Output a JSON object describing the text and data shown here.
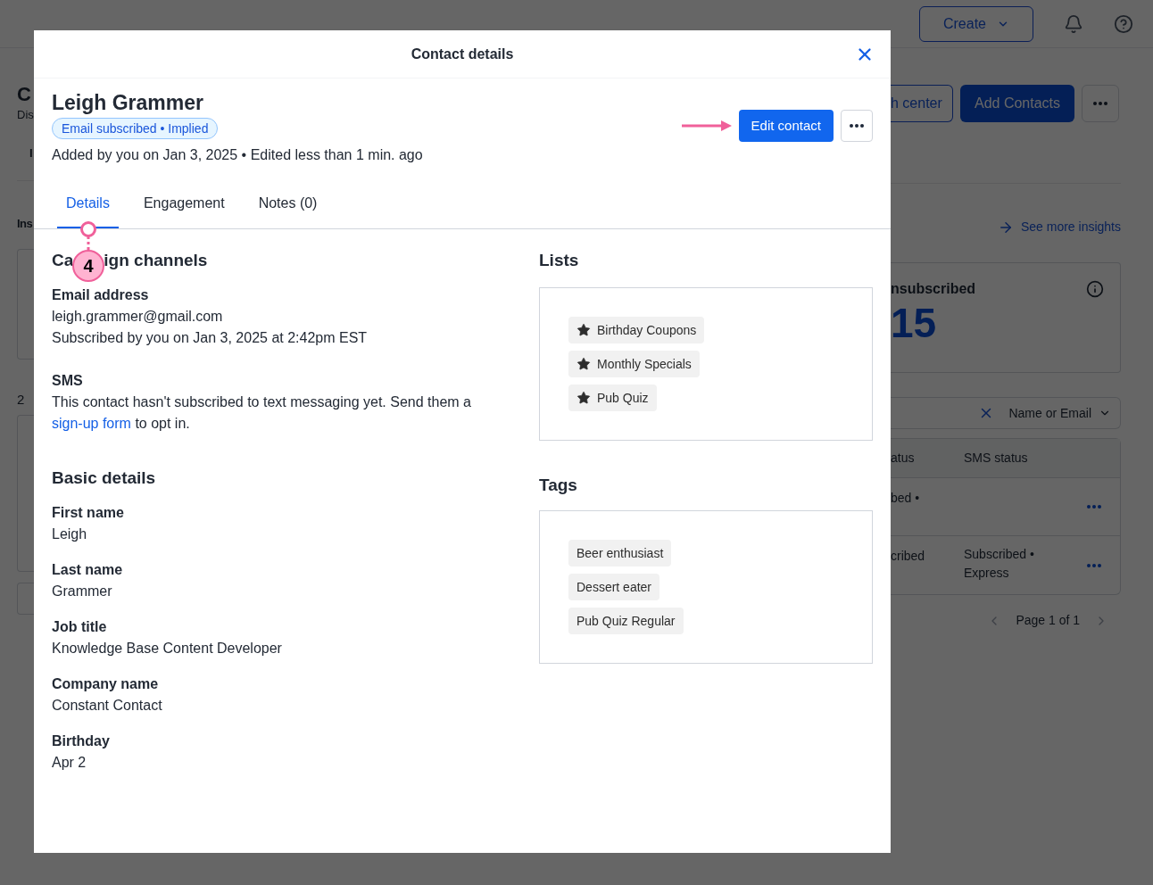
{
  "background_page": {
    "header": {
      "create_button": "Create"
    },
    "left_fragments": {
      "title": "C",
      "subtitle": "Dis",
      "tab": "I",
      "section": "Ins",
      "count": "2"
    },
    "actions": {
      "help_center": "h center",
      "add_contacts": "Add Contacts"
    },
    "see_more_link": "See more insights",
    "card": {
      "label": "nsubscribed",
      "value": "15"
    },
    "search": {
      "filter": "Name or Email"
    },
    "table": {
      "columns": [
        "atus",
        "SMS status"
      ],
      "rows": [
        {
          "cells": [
            "bed •",
            ""
          ]
        },
        {
          "cells": [
            "cribed",
            "Subscribed • Express"
          ]
        }
      ]
    },
    "pagination": "Page 1 of 1"
  },
  "modal": {
    "title": "Contact details",
    "contact": {
      "name": "Leigh Grammer",
      "status_badge": "Email subscribed • Implied",
      "meta": "Added by you on Jan 3, 2025 • Edited less than 1 min. ago"
    },
    "edit_button": "Edit contact",
    "tabs": [
      {
        "label": "Details",
        "selected": true
      },
      {
        "label": "Engagement",
        "selected": false
      },
      {
        "label": "Notes (0)",
        "selected": false
      }
    ],
    "campaign_channels": {
      "heading_parts": [
        "Ca",
        "ign channels"
      ],
      "email": {
        "label": "Email address",
        "value": "leigh.grammer@gmail.com",
        "note": "Subscribed by you on Jan 3, 2025 at 2:42pm EST"
      },
      "sms": {
        "label": "SMS",
        "text": "This contact hasn't subscribed to text messaging yet. Send them a",
        "link": "sign-up form",
        "after": "to opt in."
      }
    },
    "basic_details": {
      "heading": "Basic details",
      "fields": [
        {
          "label": "First name",
          "value": "Leigh"
        },
        {
          "label": "Last name",
          "value": "Grammer"
        },
        {
          "label": "Job title",
          "value": "Knowledge Base Content Developer"
        },
        {
          "label": "Company name",
          "value": "Constant Contact"
        },
        {
          "label": "Birthday",
          "value": "Apr 2"
        }
      ]
    },
    "lists": {
      "heading": "Lists",
      "items": [
        "Birthday Coupons",
        "Monthly Specials",
        "Pub Quiz"
      ]
    },
    "tags": {
      "heading": "Tags",
      "items": [
        "Beer enthusiast",
        "Dessert eater",
        "Pub Quiz Regular"
      ]
    },
    "annotation": {
      "step": "4"
    }
  }
}
